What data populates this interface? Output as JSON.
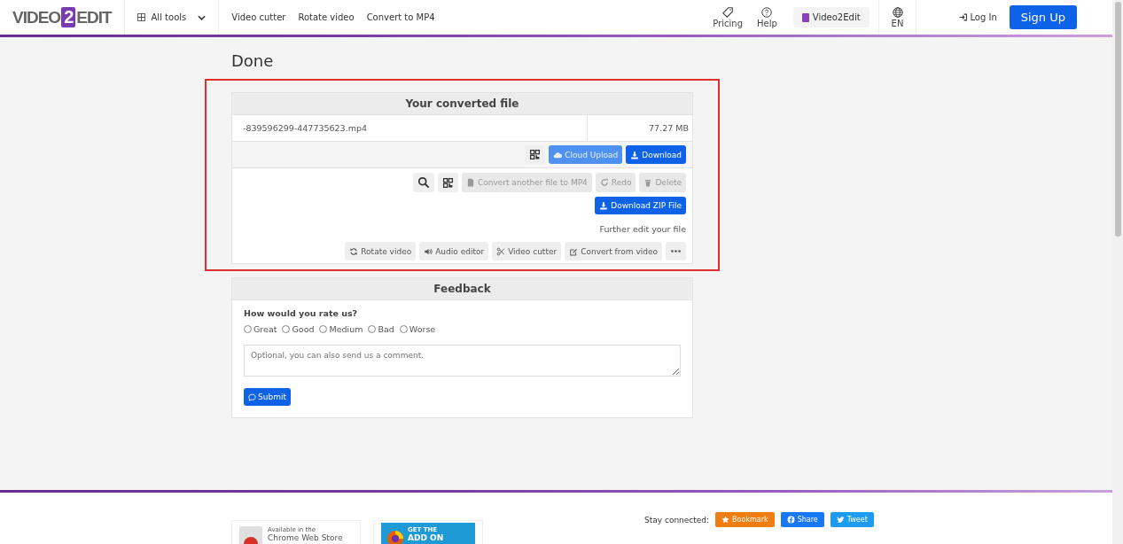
{
  "header": {
    "logo": {
      "left": "VIDEO",
      "mark": "2",
      "right": "EDIT"
    },
    "all_tools": "All tools",
    "nav_links": [
      "Video cutter",
      "Rotate video",
      "Convert to MP4"
    ],
    "pricing": "Pricing",
    "help": "Help",
    "brand_button": "Video2Edit",
    "language": "EN",
    "login": "Log In",
    "signup": "Sign Up"
  },
  "page_title": "Done",
  "result_card": {
    "title": "Your converted file",
    "file_name": "-839596299-447735623.mp4",
    "file_size": "77.27 MB",
    "file_actions": [
      {
        "kind": "qr"
      },
      {
        "kind": "cloud",
        "label": "Cloud Upload",
        "disabled": true
      },
      {
        "kind": "download",
        "label": "Download",
        "disabled": false
      }
    ],
    "tools": [
      {
        "kind": "search"
      },
      {
        "kind": "qr"
      },
      {
        "kind": "file",
        "label": "Convert another file to MP4",
        "disabled": true
      },
      {
        "kind": "redo",
        "label": "Redo",
        "disabled": true
      },
      {
        "kind": "trash",
        "label": "Delete",
        "disabled": true
      }
    ],
    "zip_button": {
      "kind": "download",
      "label": "Download ZIP File",
      "disabled": false
    },
    "further_label": "Further edit your file",
    "edit_tools": [
      {
        "kind": "rotate",
        "label": "Rotate video",
        "disabled": false
      },
      {
        "kind": "audio",
        "label": "Audio editor",
        "disabled": false
      },
      {
        "kind": "scissors",
        "label": "Video cutter",
        "disabled": false
      },
      {
        "kind": "edit",
        "label": "Convert from video",
        "disabled": false
      },
      {
        "kind": "more"
      }
    ]
  },
  "feedback": {
    "title": "Feedback",
    "question": "How would you rate us?",
    "ratings": [
      {
        "label": "Great",
        "selected": false
      },
      {
        "label": "Good",
        "selected": false
      },
      {
        "label": "Medium",
        "selected": false
      },
      {
        "label": "Bad",
        "selected": false
      },
      {
        "label": "Worse",
        "selected": false
      }
    ],
    "comment": {
      "placeholder": "Optional, you can also send us a comment."
    },
    "submit": "Submit"
  },
  "footer": {
    "chrome_badge": [
      "Available in the",
      "Chrome Web Store"
    ],
    "firefox_badge": [
      "GET THE",
      "ADD ON"
    ],
    "stay_connected": "Stay connected:",
    "social": [
      {
        "kind": "star",
        "label": "Bookmark",
        "color": "#f07d10"
      },
      {
        "kind": "facebook",
        "label": "Share",
        "color": "#1877f2"
      },
      {
        "kind": "twitter",
        "label": "Tweet",
        "color": "#1d9bf0"
      }
    ]
  }
}
